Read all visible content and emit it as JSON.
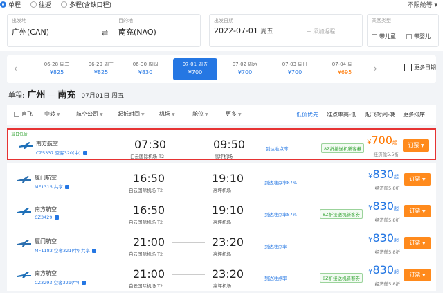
{
  "trip": {
    "types": [
      "单程",
      "往返",
      "多程(含缺口程)"
    ],
    "no_limit": "不限舱等 ▾"
  },
  "search": {
    "from_caption": "出发地",
    "from_value": "广州(CAN)",
    "to_caption": "目的地",
    "to_value": "南充(NAO)",
    "date_caption": "出发日期",
    "date_value": "2022-07-01",
    "date_weekday": "周五",
    "add_return": "+ 添加返程",
    "pax_caption": "乘客类型",
    "child": "带儿童",
    "infant": "带婴儿"
  },
  "dates": [
    {
      "d": "06-28 周二",
      "p": "¥825"
    },
    {
      "d": "06-29 周三",
      "p": "¥825"
    },
    {
      "d": "06-30 周四",
      "p": "¥830"
    },
    {
      "d": "07-01 周五",
      "p": "¥700",
      "active": true
    },
    {
      "d": "07-02 周六",
      "p": "¥700"
    },
    {
      "d": "07-03 周日",
      "p": "¥700"
    },
    {
      "d": "07-04 周一",
      "p": "¥695",
      "low": true
    }
  ],
  "more_dates": "更多日期",
  "route": {
    "label": "单程:",
    "from": "广州",
    "to": "南充",
    "date": "07月01日 周五"
  },
  "filters": {
    "direct": "直飞",
    "items": [
      "中转",
      "航空公司",
      "起抵时间",
      "机场",
      "舱位",
      "更多"
    ],
    "sorts": [
      "低价优先",
      "准点率高-低",
      "起飞时间-晚",
      "更多排序"
    ]
  },
  "flights": [
    {
      "badge": "当日低价",
      "airline": "南方航空",
      "fno": "CZ5337 空客320(中)",
      "dep": "07:30",
      "arr": "09:50",
      "dep_ap": "白云国际机场 T2",
      "arr_ap": "高坪机场",
      "punct": "到达准点率",
      "promo": "8Z折接送机新客券",
      "price": "700",
      "cabin": "经济舱5.5折",
      "low": true,
      "logo": "#1d6fb8"
    },
    {
      "badge": "",
      "airline": "厦门航空",
      "fno": "MF1315",
      "share": "共享",
      "dep": "16:50",
      "arr": "19:10",
      "dep_ap": "白云国际机场 T2",
      "arr_ap": "高坪机场",
      "punct": "到达准点率87%",
      "promo": "",
      "price": "830",
      "cabin": "经济舱5.8折",
      "low": false,
      "logo": "#2a6fb0"
    },
    {
      "badge": "",
      "airline": "南方航空",
      "fno": "CZ3429",
      "dep": "16:50",
      "arr": "19:10",
      "dep_ap": "白云国际机场 T2",
      "arr_ap": "高坪机场",
      "punct": "到达准点率87%",
      "promo": "8Z折接送机新客券",
      "price": "830",
      "cabin": "经济舱5.8折",
      "low": false,
      "logo": "#1d6fb8"
    },
    {
      "badge": "",
      "airline": "厦门航空",
      "fno": "MF1183 空客321(中)",
      "share": "共享",
      "dep": "21:00",
      "arr": "23:20",
      "dep_ap": "白云国际机场 T2",
      "arr_ap": "高坪机场",
      "punct": "到达准点率",
      "promo": "",
      "price": "830",
      "cabin": "经济舱5.8折",
      "low": false,
      "logo": "#2a6fb0"
    },
    {
      "badge": "",
      "airline": "南方航空",
      "fno": "CZ3293 空客321(中)",
      "dep": "21:00",
      "arr": "23:20",
      "dep_ap": "白云国际机场 T2",
      "arr_ap": "高坪机场",
      "punct": "到达准点率",
      "promo": "8Z折接送机新客券",
      "price": "830",
      "cabin": "经济舱5.8折",
      "low": false,
      "logo": "#1d6fb8"
    }
  ],
  "price_currency": "¥",
  "price_suffix": "起",
  "book_label": "订票",
  "colors": {
    "accent": "#2577e3",
    "highlight": "#e63333",
    "orange": "#ff8a1c",
    "green": "#39a639"
  }
}
